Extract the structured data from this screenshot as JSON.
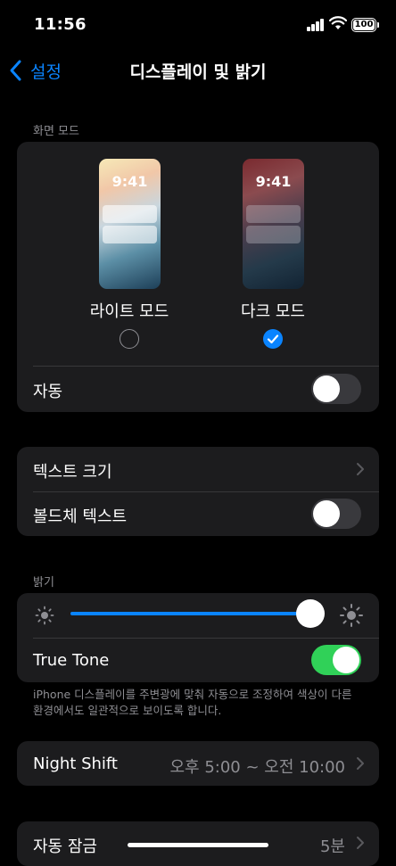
{
  "status_bar": {
    "time": "11:56",
    "battery": "100"
  },
  "nav": {
    "back_label": "설정",
    "title": "디스플레이 및 밝기"
  },
  "appearance": {
    "header": "화면 모드",
    "light": {
      "clock": "9:41",
      "label": "라이트 모드",
      "selected": false
    },
    "dark": {
      "clock": "9:41",
      "label": "다크 모드",
      "selected": true
    },
    "automatic": {
      "label": "자동",
      "on": false
    }
  },
  "text": {
    "text_size_label": "텍스트 크기",
    "bold_text_label": "볼드체 텍스트",
    "bold_text_on": false
  },
  "brightness": {
    "header": "밝기",
    "level": 0.95,
    "true_tone": {
      "label": "True Tone",
      "on": true
    },
    "footnote": "iPhone 디스플레이를 주변광에 맞춰 자동으로 조정하여 색상이 다른 환경에서도 일관적으로 보이도록 합니다."
  },
  "night_shift": {
    "label": "Night Shift",
    "value": "오후 5:00 ~ 오전 10:00"
  },
  "auto_lock": {
    "label": "자동 잠금",
    "value": "5분"
  },
  "colors": {
    "accent": "#0a84ff",
    "toggle_on": "#30d158",
    "group_bg": "#1c1c1e"
  }
}
